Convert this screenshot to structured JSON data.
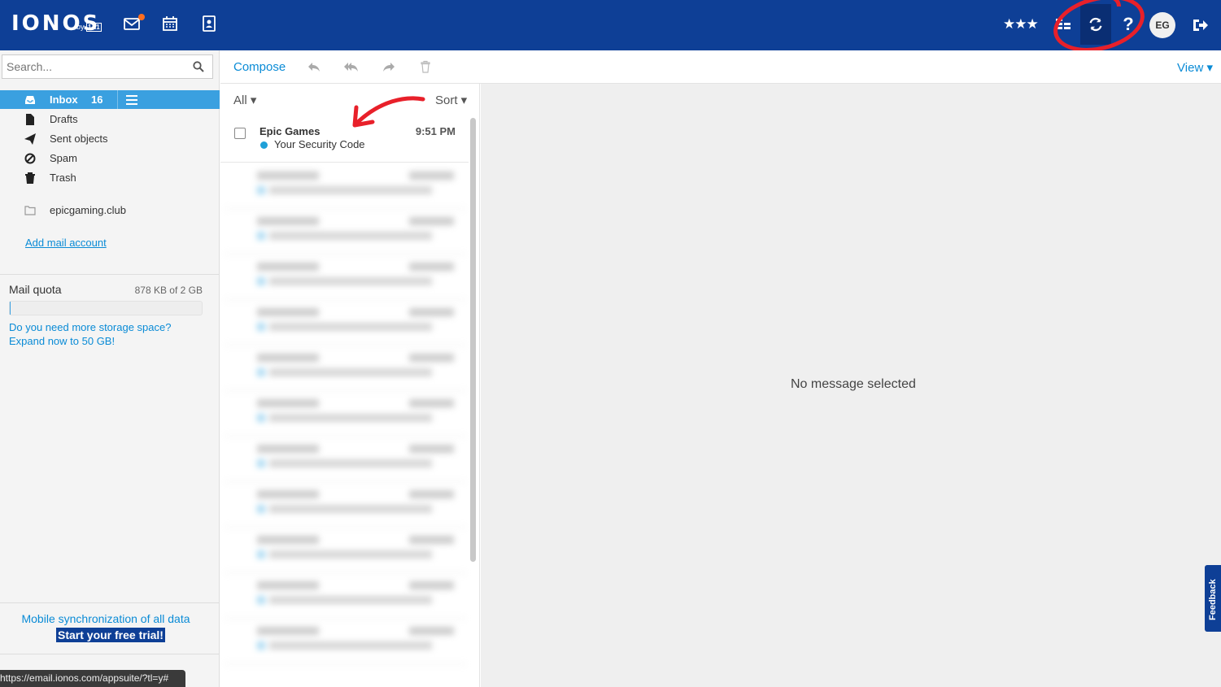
{
  "brand": {
    "logo": "IONOS",
    "by": "by",
    "partner": "1&1"
  },
  "topbar": {
    "icons": [
      "mail-icon",
      "calendar-icon",
      "contacts-icon",
      "stars-icon",
      "grid-icon",
      "refresh-icon",
      "help-icon",
      "logout-icon"
    ],
    "stars": "★★★",
    "help": "?",
    "avatar_initials": "EG"
  },
  "search": {
    "placeholder": "Search..."
  },
  "sidebar": {
    "folders": [
      {
        "label": "Inbox",
        "count": "16",
        "icon": "inbox-icon"
      },
      {
        "label": "Drafts",
        "icon": "file-icon"
      },
      {
        "label": "Sent objects",
        "icon": "send-icon"
      },
      {
        "label": "Spam",
        "icon": "block-icon"
      },
      {
        "label": "Trash",
        "icon": "trash-icon"
      }
    ],
    "account_folder": "epicgaming.club",
    "add_mail": "Add mail account",
    "quota_label": "Mail quota",
    "quota_value": "878 KB of 2 GB",
    "quota_used_fraction": 0.0004,
    "storage_question": "Do you need more storage space?",
    "storage_offer": "Expand now to 50 GB!",
    "promo_text": "Mobile synchronization of all data",
    "promo_cta": "Start your free trial!",
    "status_url": "https://email.ionos.com/appsuite/?tl=y#"
  },
  "toolbar": {
    "compose": "Compose",
    "view": "View ▾",
    "icons": [
      "reply-icon",
      "reply-all-icon",
      "forward-icon",
      "delete-icon"
    ]
  },
  "list": {
    "filter": "All ▾",
    "sort": "Sort ▾",
    "messages": [
      {
        "sender": "Epic Games",
        "time": "9:51 PM",
        "subject": "Your Security Code",
        "unread": true
      }
    ]
  },
  "reading": {
    "empty": "No message selected"
  },
  "feedback": "Feedback",
  "colors": {
    "header": "#0e3f96",
    "accent": "#3aa0e0",
    "link": "#0a8bd6",
    "annotation": "#e8202a"
  }
}
